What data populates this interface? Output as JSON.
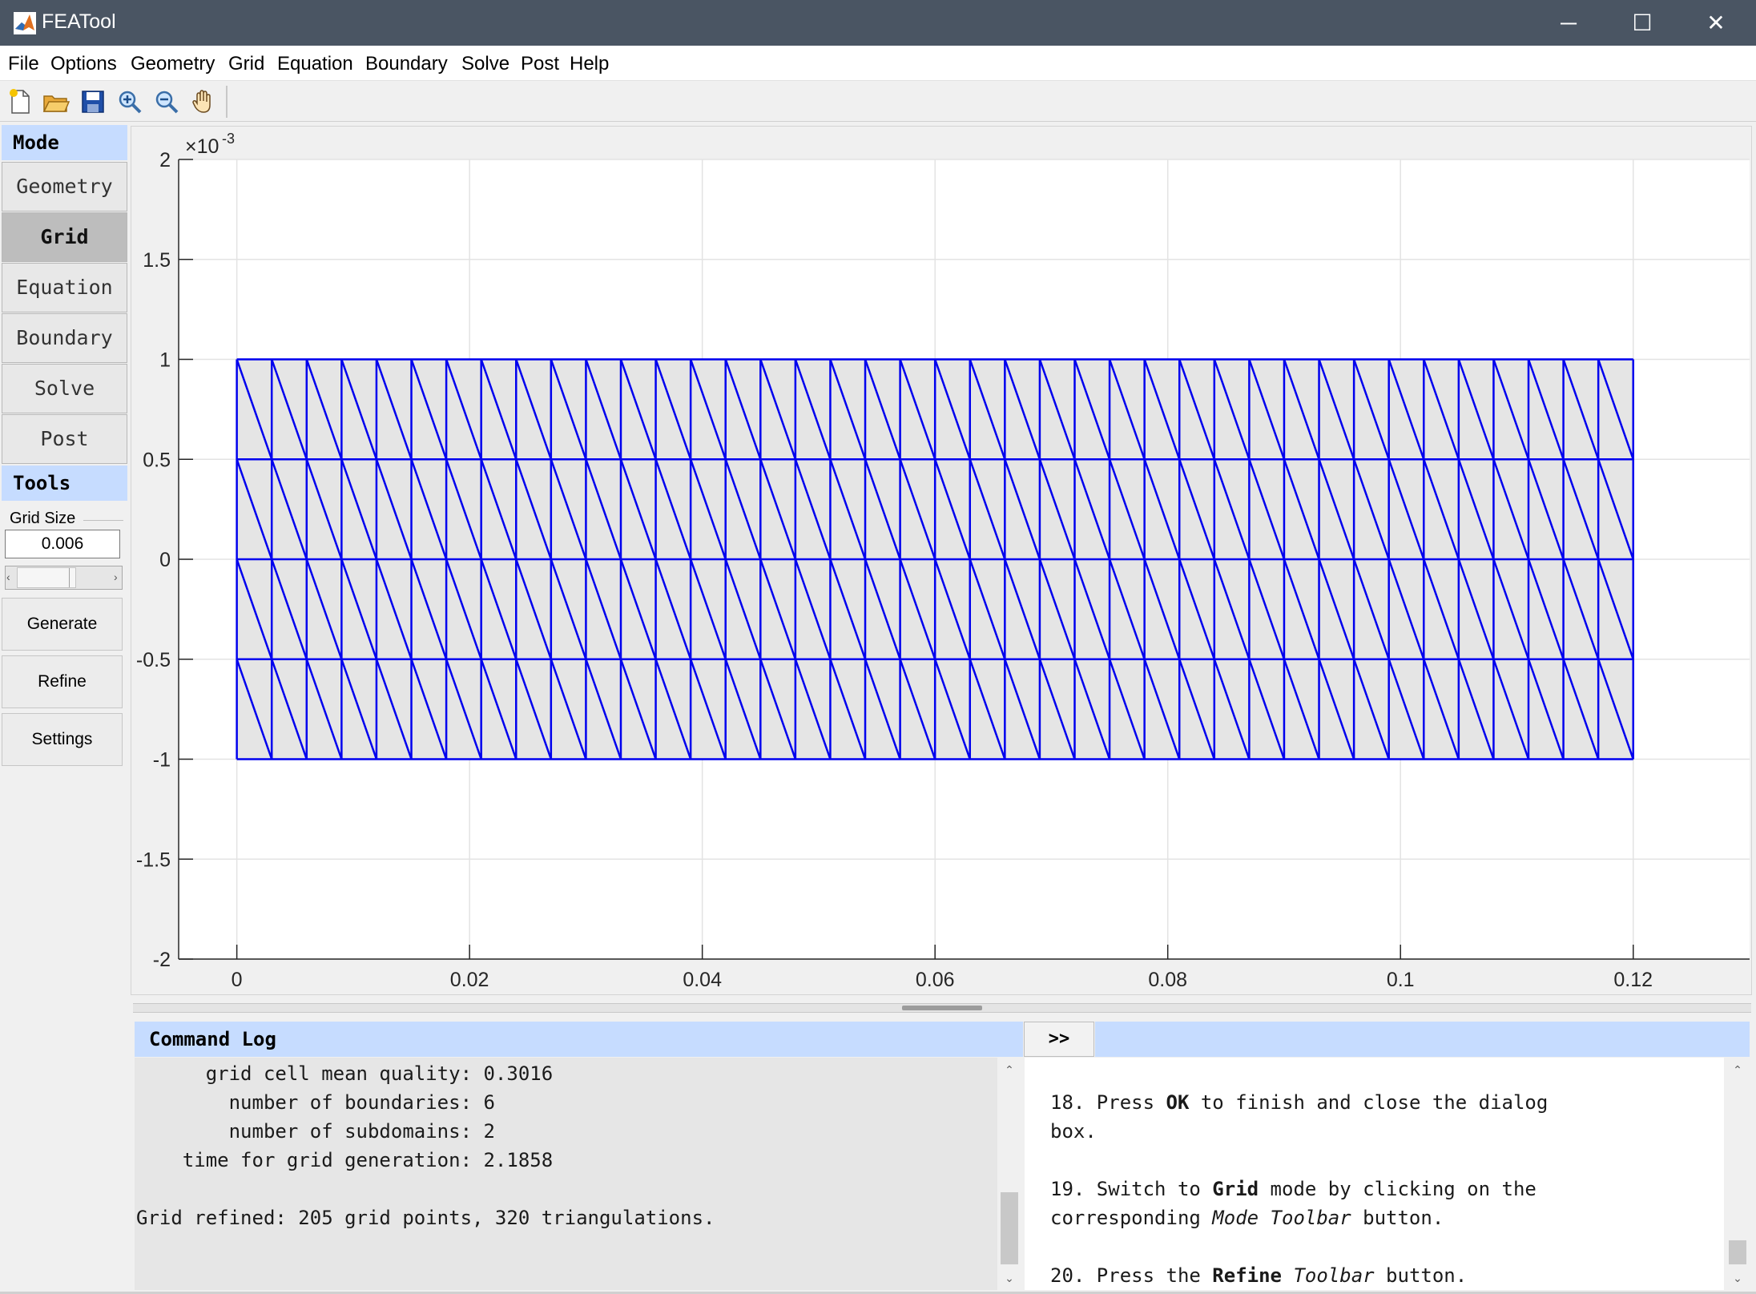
{
  "window": {
    "title": "FEATool",
    "controls": {
      "minimize": "─",
      "maximize": "☐",
      "close": "✕"
    },
    "accent_titlebar": "#4a5563"
  },
  "menu": [
    "File",
    "Options",
    "Geometry",
    "Grid",
    "Equation",
    "Boundary",
    "Solve",
    "Post",
    "Help"
  ],
  "toolbar": {
    "icons": [
      "new-file-icon",
      "open-folder-icon",
      "save-icon",
      "zoom-in-icon",
      "zoom-out-icon",
      "pan-hand-icon"
    ]
  },
  "sidebar": {
    "mode_header": "Mode",
    "modes": [
      "Geometry",
      "Grid",
      "Equation",
      "Boundary",
      "Solve",
      "Post"
    ],
    "active_mode": "Grid",
    "tools_header": "Tools",
    "grid_size_label": "Grid Size",
    "grid_size_value": "0.006",
    "slider_left": "‹",
    "slider_right": "›",
    "tool_buttons": [
      "Generate",
      "Refine",
      "Settings"
    ],
    "header_color": "#c6dcff"
  },
  "chart_data": {
    "type": "mesh",
    "title": "",
    "xlabel": "",
    "ylabel": "",
    "y_exponent_label": "×10",
    "y_exponent_power": "-3",
    "xlim": [
      -0.005,
      0.13
    ],
    "ylim": [
      -2,
      2
    ],
    "xticks": [
      "0",
      "0.02",
      "0.04",
      "0.06",
      "0.08",
      "0.1",
      "0.12"
    ],
    "xtick_values": [
      0,
      0.02,
      0.04,
      0.06,
      0.08,
      0.1,
      0.12
    ],
    "yticks": [
      "2",
      "1.5",
      "1",
      "0.5",
      "0",
      "-0.5",
      "-1",
      "-1.5",
      "-2"
    ],
    "ytick_values": [
      2,
      1.5,
      1,
      0.5,
      0,
      -0.5,
      -1,
      -1.5,
      -2
    ],
    "grid": true,
    "mesh": {
      "x_range": [
        0,
        0.12
      ],
      "y_range": [
        -1,
        1
      ],
      "columns": 40,
      "rows": 4,
      "edge_color": "#0000ee",
      "fill_color": "#e5e5e5"
    }
  },
  "log": {
    "header": "Command Log",
    "expand_label": ">>",
    "lines": [
      "      grid cell mean quality: 0.3016",
      "        number of boundaries: 6",
      "        number of subdomains: 2",
      "    time for grid generation: 2.1858",
      "",
      "Grid refined: 205 grid points, 320 triangulations."
    ],
    "scroll_up": "⌃",
    "scroll_down": "⌄"
  },
  "tutorial": {
    "step18_a": "18. Press ",
    "step18_b": "OK",
    "step18_c": " to finish and close the dialog",
    "step18_d": "box.",
    "step19_a": "19. Switch to ",
    "step19_b": "Grid",
    "step19_c": " mode by clicking on the",
    "step19_d": "corresponding ",
    "step19_e": "Mode Toolbar",
    "step19_f": " button.",
    "step20_a": "20. Press the ",
    "step20_b": "Refine",
    "step20_c": " ",
    "step20_d": "Toolbar",
    "step20_e": " button."
  }
}
